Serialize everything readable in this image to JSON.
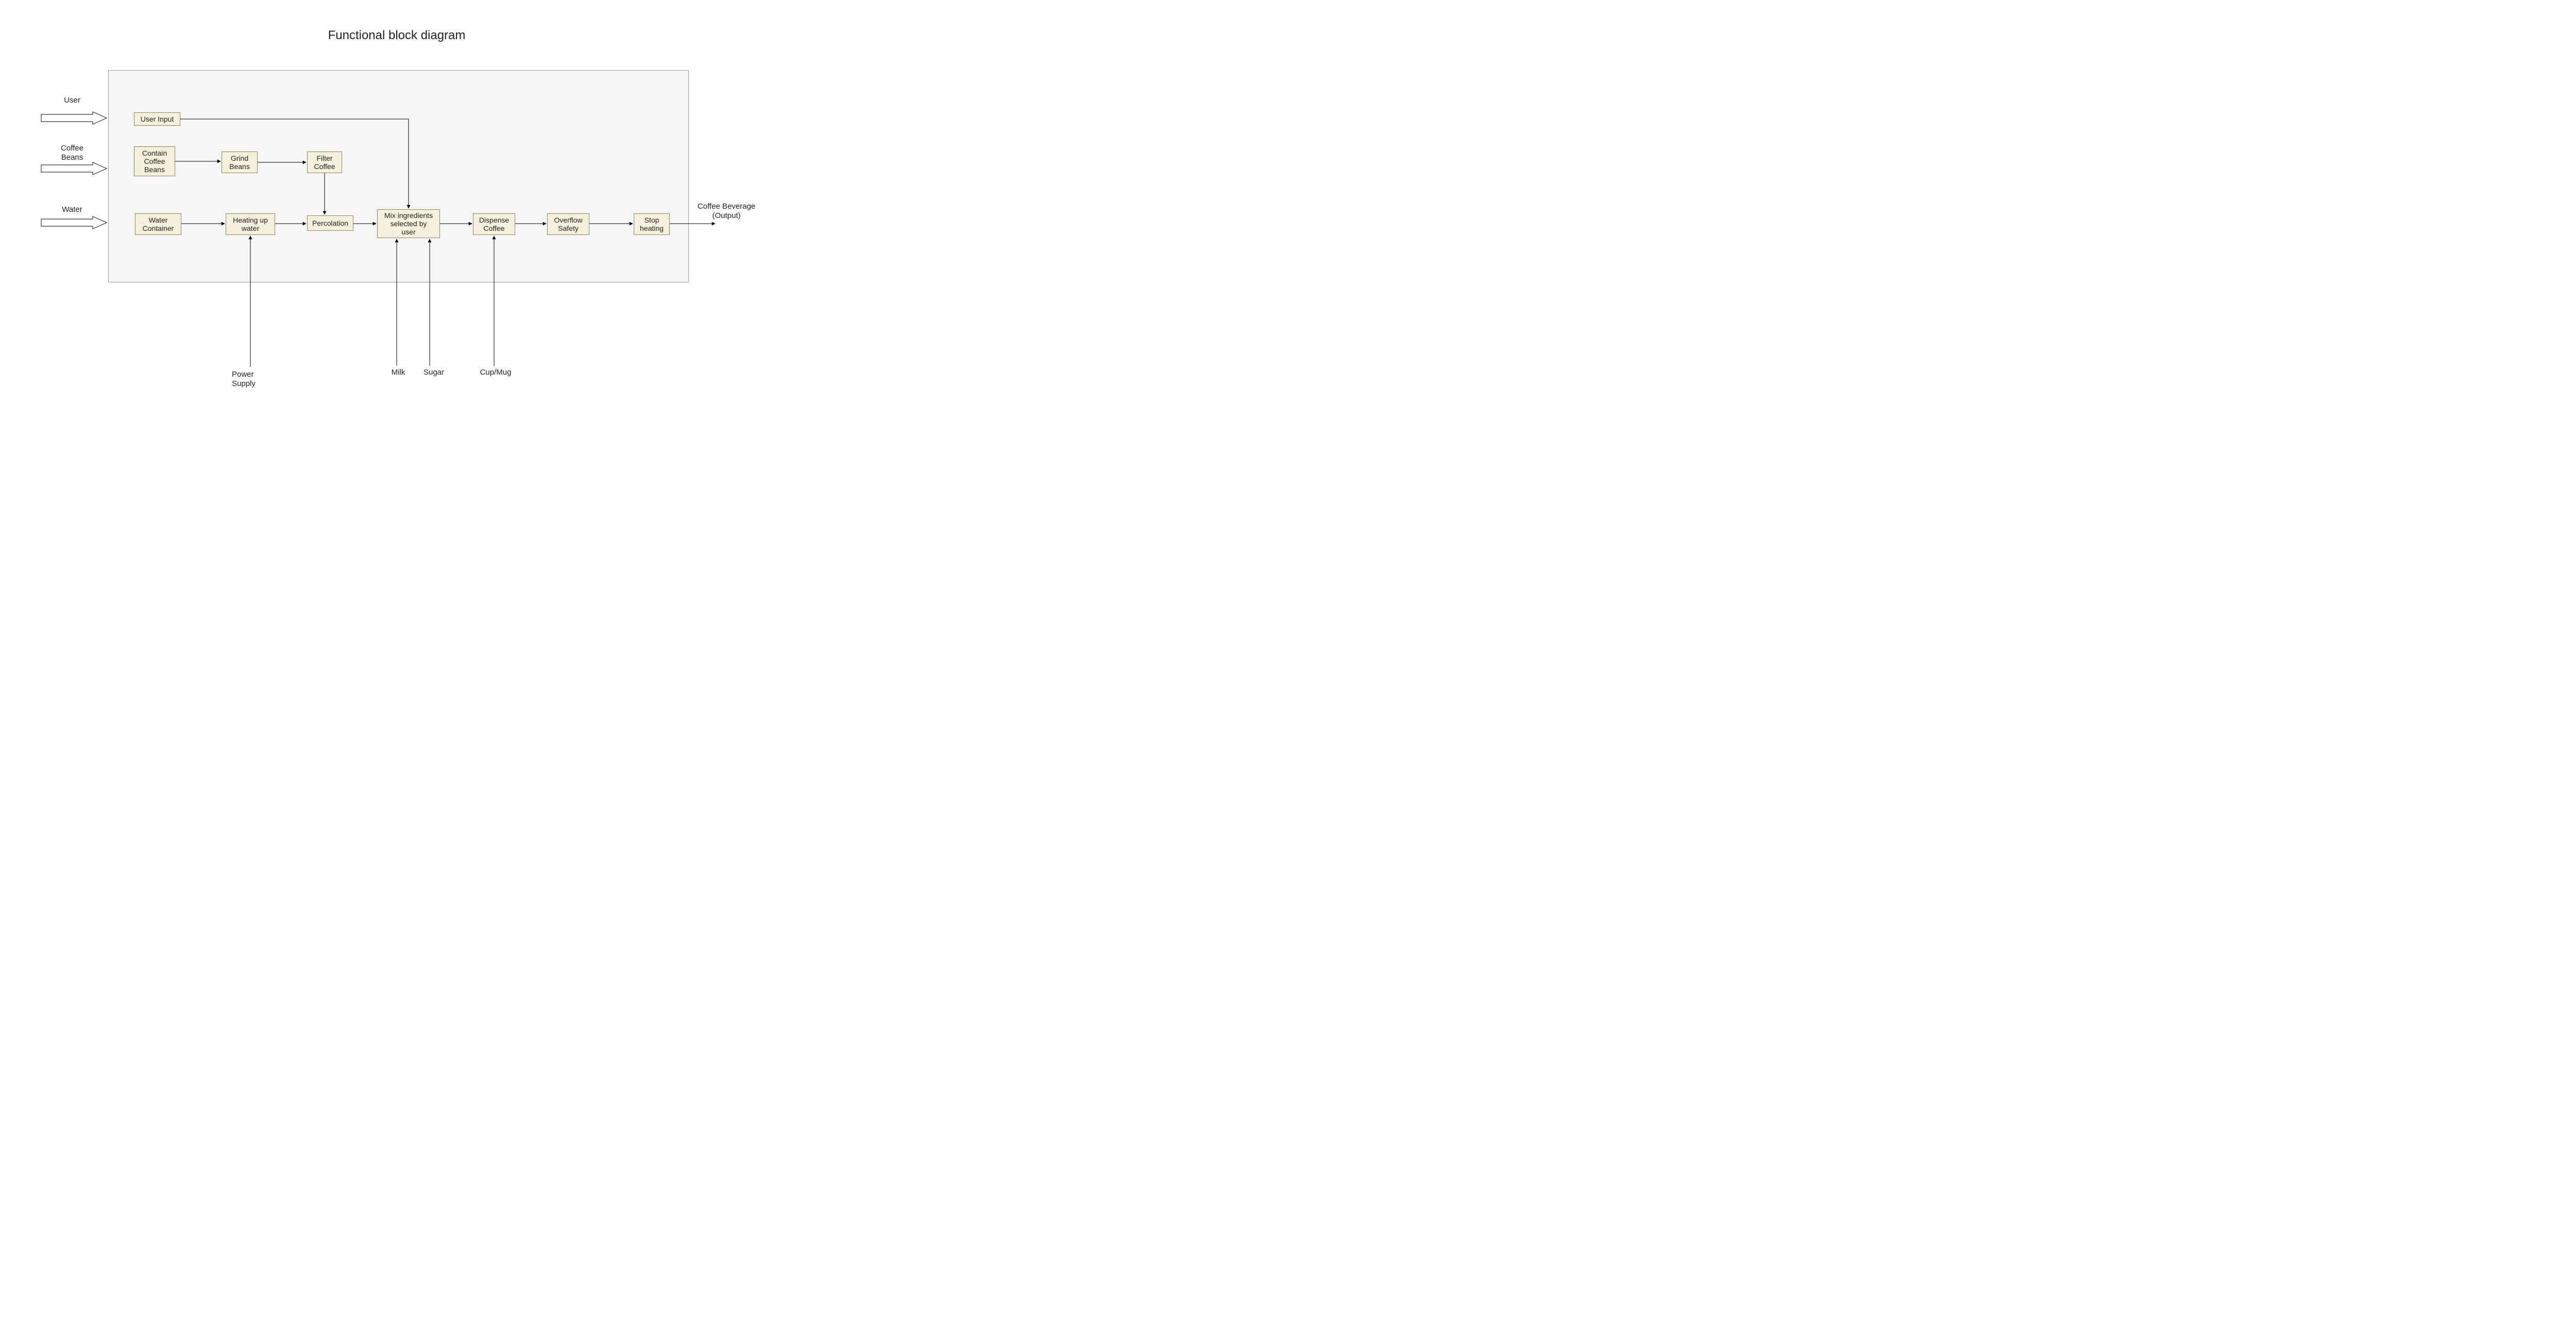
{
  "title": "Functional block diagram",
  "inputs": {
    "user": "User",
    "coffee_beans": "Coffee\nBeans",
    "water": "Water",
    "power_supply": "Power\nSupply",
    "milk": "Milk",
    "sugar": "Sugar",
    "cup": "Cup/Mug"
  },
  "output_label": "Coffee Beverage\n(Output)",
  "blocks": {
    "user_input": "User Input",
    "contain_beans": "Contain\nCoffee\nBeans",
    "grind_beans": "Grind\nBeans",
    "filter_coffee": "Filter\nCoffee",
    "water_container": "Water\nContainer",
    "heating": "Heating up\nwater",
    "percolation": "Percolation",
    "mix": "Mix ingredients\nselected by\nuser",
    "dispense": "Dispense\nCoffee",
    "overflow": "Overflow\nSafety",
    "stop_heating": "Stop\nheating"
  }
}
